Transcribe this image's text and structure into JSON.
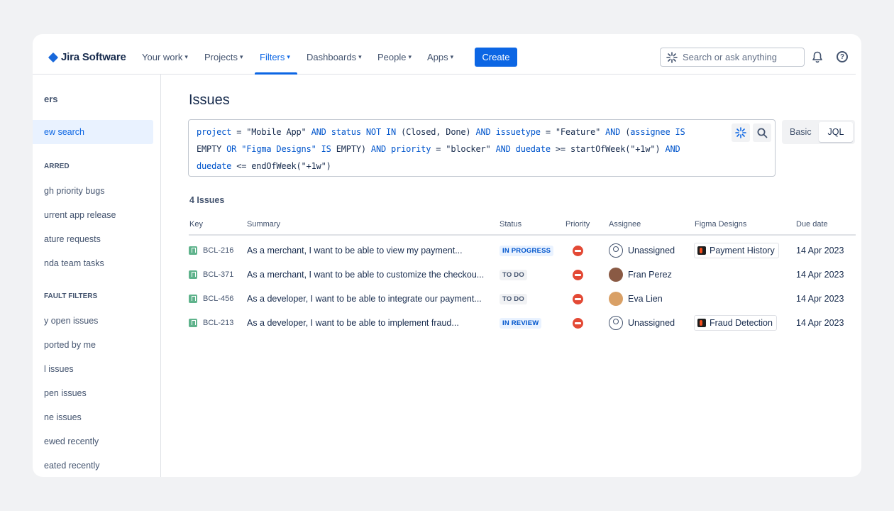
{
  "app": {
    "name": "Jira Software"
  },
  "nav": {
    "items": [
      {
        "label": "Your work"
      },
      {
        "label": "Projects"
      },
      {
        "label": "Filters"
      },
      {
        "label": "Dashboards"
      },
      {
        "label": "People"
      },
      {
        "label": "Apps"
      }
    ],
    "active": "Filters",
    "create_label": "Create",
    "search_placeholder": "Search or ask anything",
    "accent": "#0c66e4"
  },
  "sidebar": {
    "title": "ers",
    "selected": "ew search",
    "starred_heading": "ARRED",
    "starred": [
      "gh priority bugs",
      "urrent app release",
      "ature requests",
      "nda team tasks"
    ],
    "default_heading": "FAULT FILTERS",
    "defaults": [
      "y open issues",
      "ported by me",
      "l issues",
      "pen issues",
      "ne issues",
      "ewed recently",
      "eated recently"
    ]
  },
  "main": {
    "title": "Issues",
    "toggle": {
      "basic": "Basic",
      "jql": "JQL",
      "selected": "JQL"
    },
    "jql": {
      "line1": [
        {
          "t": "project",
          "c": "fld"
        },
        {
          "t": " = \"Mobile App\" ",
          "c": "str"
        },
        {
          "t": "AND",
          "c": "kw"
        },
        {
          "t": " ",
          "c": "str"
        },
        {
          "t": "status",
          "c": "fld"
        },
        {
          "t": " ",
          "c": "str"
        },
        {
          "t": "NOT IN",
          "c": "kw"
        },
        {
          "t": " (Closed, Done) ",
          "c": "str"
        },
        {
          "t": "AND",
          "c": "kw"
        },
        {
          "t": " ",
          "c": "str"
        },
        {
          "t": "issuetype",
          "c": "fld"
        },
        {
          "t": " = \"Feature\" ",
          "c": "str"
        },
        {
          "t": "AND",
          "c": "kw"
        },
        {
          "t": " (",
          "c": "str"
        },
        {
          "t": "assignee",
          "c": "fld"
        },
        {
          "t": " ",
          "c": "str"
        },
        {
          "t": "IS",
          "c": "kw"
        }
      ],
      "line2": [
        {
          "t": "EMPTY",
          "c": "str"
        },
        {
          "t": " ",
          "c": "str"
        },
        {
          "t": "OR",
          "c": "kw"
        },
        {
          "t": " ",
          "c": "str"
        },
        {
          "t": "\"Figma Designs\"",
          "c": "fld"
        },
        {
          "t": " ",
          "c": "str"
        },
        {
          "t": "IS",
          "c": "kw"
        },
        {
          "t": " EMPTY) ",
          "c": "str"
        },
        {
          "t": "AND",
          "c": "kw"
        },
        {
          "t": " ",
          "c": "str"
        },
        {
          "t": "priority",
          "c": "fld"
        },
        {
          "t": " = \"blocker\" ",
          "c": "str"
        },
        {
          "t": "AND",
          "c": "kw"
        },
        {
          "t": " ",
          "c": "str"
        },
        {
          "t": "duedate",
          "c": "fld"
        },
        {
          "t": " >= startOfWeek(\"+1w\") ",
          "c": "str"
        },
        {
          "t": "AND",
          "c": "kw"
        }
      ],
      "line3": [
        {
          "t": "duedate",
          "c": "fld"
        },
        {
          "t": " <= endOfWeek(\"+1w\")",
          "c": "str"
        }
      ]
    },
    "count": "4 Issues",
    "columns": [
      "Key",
      "Summary",
      "Status",
      "Priority",
      "Assignee",
      "Figma Designs",
      "Due date"
    ],
    "rows": [
      {
        "key": "BCL-216",
        "summary": "As a merchant, I want to be able to view my payment...",
        "status": "IN PROGRESS",
        "status_style": "blue",
        "assignee": "Unassigned",
        "avatar": "unassigned",
        "figma": "Payment History",
        "due": "14 Apr 2023"
      },
      {
        "key": "BCL-371",
        "summary": "As a merchant, I want to be able to customize the checkou...",
        "status": "TO DO",
        "status_style": "gray",
        "assignee": "Fran Perez",
        "avatar": "fran",
        "figma": "",
        "due": "14 Apr 2023"
      },
      {
        "key": "BCL-456",
        "summary": "As a developer, I want to be able to integrate our payment...",
        "status": "TO DO",
        "status_style": "gray",
        "assignee": "Eva Lien",
        "avatar": "eva",
        "figma": "",
        "due": "14 Apr 2023"
      },
      {
        "key": "BCL-213",
        "summary": "As a developer, I want to be able to implement fraud...",
        "status": "IN REVIEW",
        "status_style": "blue",
        "assignee": "Unassigned",
        "avatar": "unassigned",
        "figma": "Fraud Detection",
        "due": "14 Apr 2023"
      }
    ]
  }
}
